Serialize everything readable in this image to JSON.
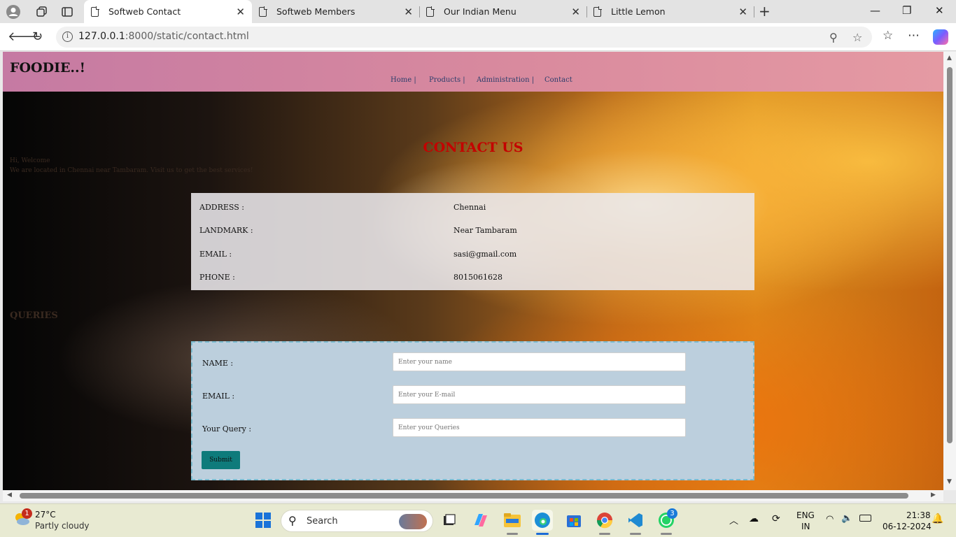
{
  "browser": {
    "tabs": [
      {
        "title": "Softweb Contact",
        "active": true
      },
      {
        "title": "Softweb Members",
        "active": false
      },
      {
        "title": "Our Indian Menu",
        "active": false
      },
      {
        "title": "Little Lemon",
        "active": false
      }
    ],
    "address": {
      "host": "127.0.0.1",
      "rest": ":8000/static/contact.html"
    }
  },
  "site": {
    "brand": "FOODIE..!",
    "nav": [
      "Home |",
      "Products |",
      "Administration |",
      "Contact"
    ],
    "contact_title": "CONTACT US",
    "faint_line1": "Hi, Welcome",
    "faint_line2": "We are located in Chennai near Tambaram. Visit us to get the best services!",
    "faint_heading": "QUERIES",
    "info_rows": [
      {
        "label": "ADDRESS :",
        "value": "Chennai"
      },
      {
        "label": "LANDMARK :",
        "value": "Near Tambaram"
      },
      {
        "label": "EMAIL :",
        "value": "sasi@gmail.com"
      },
      {
        "label": "PHONE :",
        "value": "8015061628"
      }
    ],
    "form": {
      "fields": [
        {
          "label": "NAME :",
          "placeholder": "Enter your name"
        },
        {
          "label": "EMAIL :",
          "placeholder": "Enter your E-mail"
        },
        {
          "label": "Your Query :",
          "placeholder": "Enter your Queries"
        }
      ],
      "submit": "Submit"
    }
  },
  "taskbar": {
    "weather_temp": "27°C",
    "weather_desc": "Partly cloudy",
    "weather_badge": "1",
    "search_label": "Search",
    "whatsapp_badge": "3",
    "lang1": "ENG",
    "lang2": "IN",
    "time": "21:38",
    "date": "06-12-2024"
  },
  "colors": {
    "header_pink": "#d98a9e",
    "title_red": "#c40000",
    "form_panel": "#bccfdd",
    "submit_teal": "#0e7b7b"
  }
}
